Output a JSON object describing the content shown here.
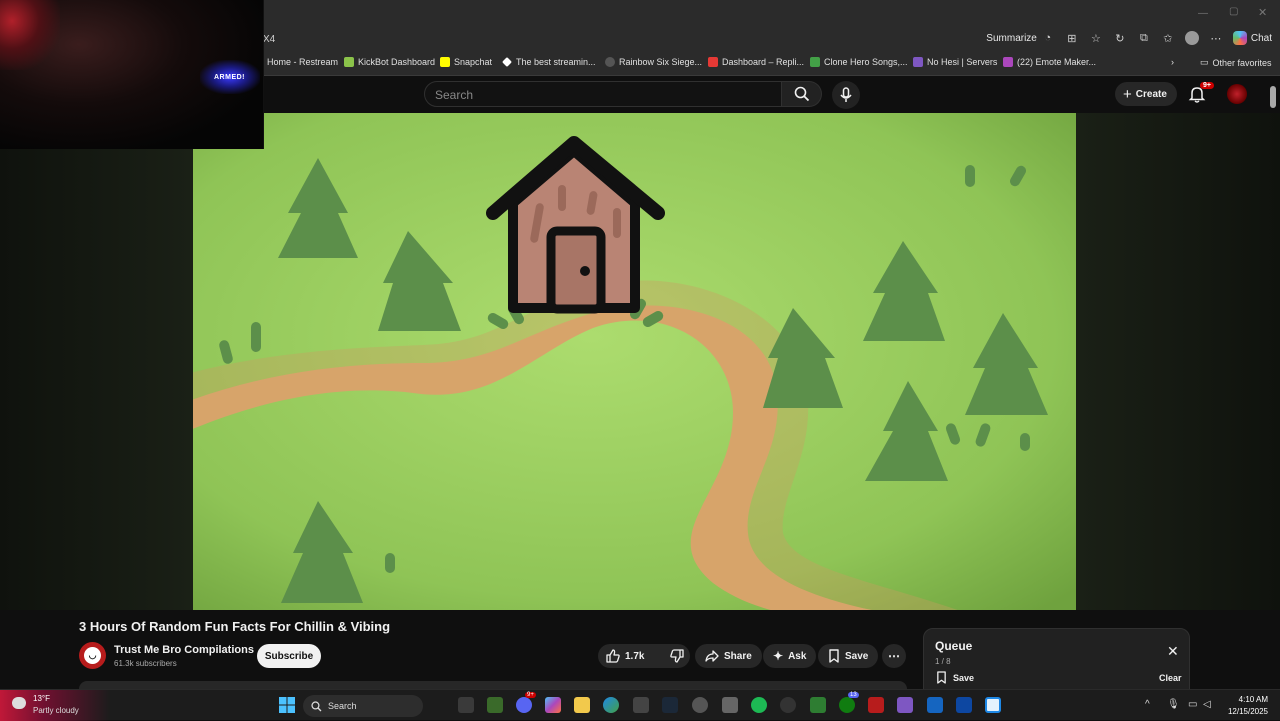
{
  "browser": {
    "url_fragment": "X4",
    "summarize_label": "Summarize",
    "chat_label": "Chat",
    "bookmarks": [
      {
        "label": "Home - Restream",
        "color": "#2a2a2a"
      },
      {
        "label": "KickBot Dashboard",
        "color": "#8bc34a"
      },
      {
        "label": "Snapchat",
        "color": "#fffc00"
      },
      {
        "label": "The best streamin...",
        "color": "#ffffff"
      },
      {
        "label": "Rainbow Six Siege...",
        "color": "#555555"
      },
      {
        "label": "Dashboard – Repli...",
        "color": "#e53935"
      },
      {
        "label": "Clone Hero Songs,...",
        "color": "#43a047"
      },
      {
        "label": "No Hesi | Servers",
        "color": "#7e57c2"
      },
      {
        "label": "(22) Emote Maker...",
        "color": "#ab47bc"
      }
    ],
    "other_favorites_label": "Other favorites"
  },
  "webcam": {
    "label": "ARMED!"
  },
  "youtube": {
    "search_placeholder": "Search",
    "create_label": "Create",
    "notifications_badge": "9+",
    "video": {
      "title": "3 Hours Of Random Fun Facts For Chillin & Vibing",
      "channel": "Trust Me Bro Compilations",
      "subscribers": "61.3k subscribers",
      "subscribe_label": "Subscribe",
      "likes": "1.7k",
      "share_label": "Share",
      "ask_label": "Ask",
      "save_label": "Save"
    },
    "queue": {
      "title": "Queue",
      "count": "1 / 8",
      "save_label": "Save",
      "clear_label": "Clear"
    }
  },
  "taskbar": {
    "weather_temp": "13°F",
    "weather_condition": "Partly cloudy",
    "search_label": "Search",
    "time": "4:10 AM",
    "date": "12/15/2025",
    "discord_badge": "9+",
    "xbox_badge": "13"
  },
  "colors": {
    "grass": "#9ccf5f",
    "path": "#d7a46a",
    "tree": "#5c8f4a",
    "house_wall": "#b98474",
    "youtube_red": "#cc0000"
  }
}
